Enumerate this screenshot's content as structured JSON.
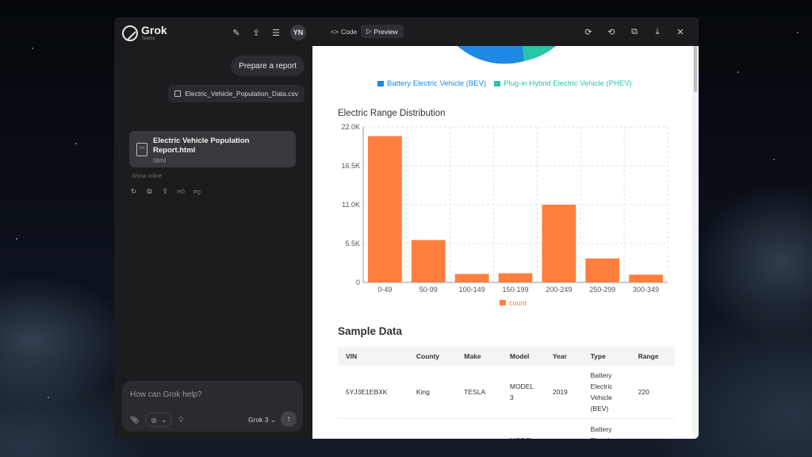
{
  "sidebar": {
    "logo_name": "Grok",
    "logo_sub": "Teams",
    "avatar": "YN",
    "icons": [
      "edit-icon",
      "upload-icon",
      "history-icon"
    ]
  },
  "chat": {
    "user_message": "Prepare a report",
    "attachment": "Electric_Vehicle_Population_Data.csv",
    "artifact_title": "Electric Vehicle Population Report.html",
    "artifact_type": "html",
    "show_inline": "Show inline"
  },
  "composer": {
    "placeholder": "How can Grok help?",
    "model": "Grok 3"
  },
  "preview": {
    "tab_code": "Code",
    "tab_preview": "Preview"
  },
  "pie_legend": {
    "bev": "Battery Electric Vehicle (BEV)",
    "phev": "Plug-in Hybrid Electric Vehicle (PHEV)",
    "bev_color": "#1e88e5",
    "phev_color": "#26c6a6"
  },
  "chart_data": {
    "type": "bar",
    "title": "Electric Range Distribution",
    "categories": [
      "0-49",
      "50-99",
      "100-149",
      "150-199",
      "200-249",
      "250-299",
      "300-349"
    ],
    "series": [
      {
        "name": "count",
        "values": [
          20700,
          6000,
          1200,
          1300,
          11000,
          3400,
          1100
        ]
      }
    ],
    "yticks": [
      "0",
      "5.5K",
      "11.0K",
      "16.5K",
      "22.0K"
    ],
    "ylim": [
      0,
      22000
    ],
    "color": "#ff7f3f",
    "grid": true,
    "legend": "bottom"
  },
  "sample": {
    "title": "Sample Data",
    "columns": [
      "VIN",
      "County",
      "Make",
      "Model",
      "Year",
      "Type",
      "Range"
    ],
    "row1": {
      "vin": "5YJ3E1EBXK",
      "county": "King",
      "make": "TESLA",
      "model": "MODEL 3",
      "year": "2019",
      "type": "Battery Electric Vehicle (BEV)",
      "range": "220"
    },
    "row2": {
      "model": "MODEL",
      "type": "Battery Electric"
    }
  }
}
